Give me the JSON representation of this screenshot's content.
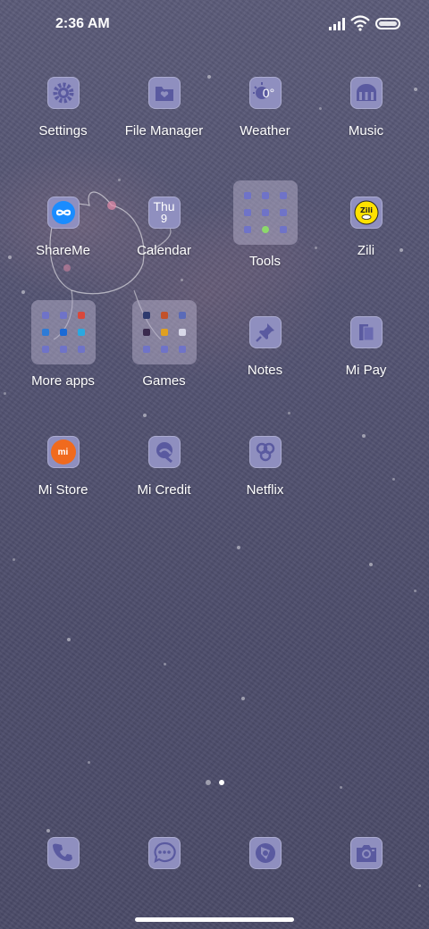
{
  "status_bar": {
    "time": "2:36 AM"
  },
  "apps": [
    {
      "label": "Settings",
      "icon": "gear-icon"
    },
    {
      "label": "File Manager",
      "icon": "folder-icon"
    },
    {
      "label": "Weather",
      "icon": "weather-icon",
      "icon_text": "0°"
    },
    {
      "label": "Music",
      "icon": "music-icon"
    },
    {
      "label": "ShareMe",
      "icon": "shareme-icon"
    },
    {
      "label": "Calendar",
      "icon": "calendar-icon",
      "icon_text": "Thu",
      "icon_sub": "9"
    },
    {
      "label": "Tools",
      "icon": "folder-icon"
    },
    {
      "label": "Zili",
      "icon": "zili-icon",
      "icon_text": "Zili"
    },
    {
      "label": "More apps",
      "icon": "folder-icon"
    },
    {
      "label": "Games",
      "icon": "folder-icon"
    },
    {
      "label": "Notes",
      "icon": "pin-icon"
    },
    {
      "label": "Mi Pay",
      "icon": "wallet-icon"
    },
    {
      "label": "Mi Store",
      "icon": "mi-store-icon",
      "icon_text": "mi"
    },
    {
      "label": "Mi Credit",
      "icon": "credit-icon"
    },
    {
      "label": "Netflix",
      "icon": "netflix-icon"
    }
  ],
  "dock": [
    {
      "icon": "phone-icon"
    },
    {
      "icon": "messages-icon"
    },
    {
      "icon": "browser-icon"
    },
    {
      "icon": "camera-icon"
    }
  ],
  "page_indicator": {
    "pages": 2,
    "current": 2
  },
  "colors": {
    "icon_bg": "#8f8fbf",
    "icon_glyph": "#5a5aa0",
    "accent_orange": "#f06a1e",
    "accent_yellow": "#ffe100",
    "shareme_blue": "#1a8cff"
  }
}
